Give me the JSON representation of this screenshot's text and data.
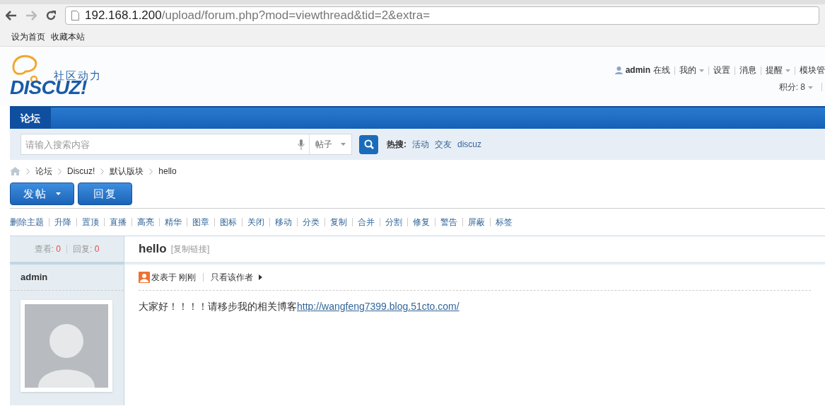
{
  "browser": {
    "address_host": "192.168.1.200",
    "address_path": "/upload/forum.php?mod=viewthread&tid=2&extra=",
    "bookmarks": [
      "设为首页",
      "收藏本站"
    ]
  },
  "header": {
    "logo_tagline": "社区动力",
    "logo_text": "DISCUZ!",
    "user_name": "admin",
    "user_status": "在线",
    "user_menu": [
      {
        "label": "我的",
        "dropdown": true
      },
      {
        "label": "设置",
        "dropdown": false
      },
      {
        "label": "消息",
        "dropdown": false
      },
      {
        "label": "提醒",
        "dropdown": true
      },
      {
        "label": "模块管",
        "dropdown": false
      }
    ],
    "credits": "积分: 8"
  },
  "nav": [
    {
      "label": "论坛",
      "selected": true
    }
  ],
  "search": {
    "placeholder": "请输入搜索内容",
    "scope": "帖子",
    "hot_label": "热搜:",
    "hot_tags": [
      "活动",
      "交友",
      "discuz"
    ]
  },
  "breadcrumb": [
    "论坛",
    "Discuz!",
    "默认版块",
    "hello"
  ],
  "buttons": [
    {
      "label": "发帖",
      "dropdown": true
    },
    {
      "label": "回复",
      "dropdown": false
    }
  ],
  "mod_actions": [
    "删除主题",
    "升降",
    "置顶",
    "直播",
    "高亮",
    "精华",
    "图章",
    "图标",
    "关闭",
    "移动",
    "分类",
    "复制",
    "合并",
    "分割",
    "修复",
    "警告",
    "屏蔽",
    "标签"
  ],
  "thread": {
    "stats": [
      {
        "label": "查看:",
        "value": "0"
      },
      {
        "label": "回复:",
        "value": "0"
      }
    ],
    "title": "hello",
    "copy_link": "[复制链接]",
    "author": "admin",
    "posted": "发表于 刚刚",
    "only_author": "只看该作者",
    "body_text": "大家好！！！！请移步我的相关博客",
    "body_link": "http://wangfeng7399.blog.51cto.com/"
  }
}
